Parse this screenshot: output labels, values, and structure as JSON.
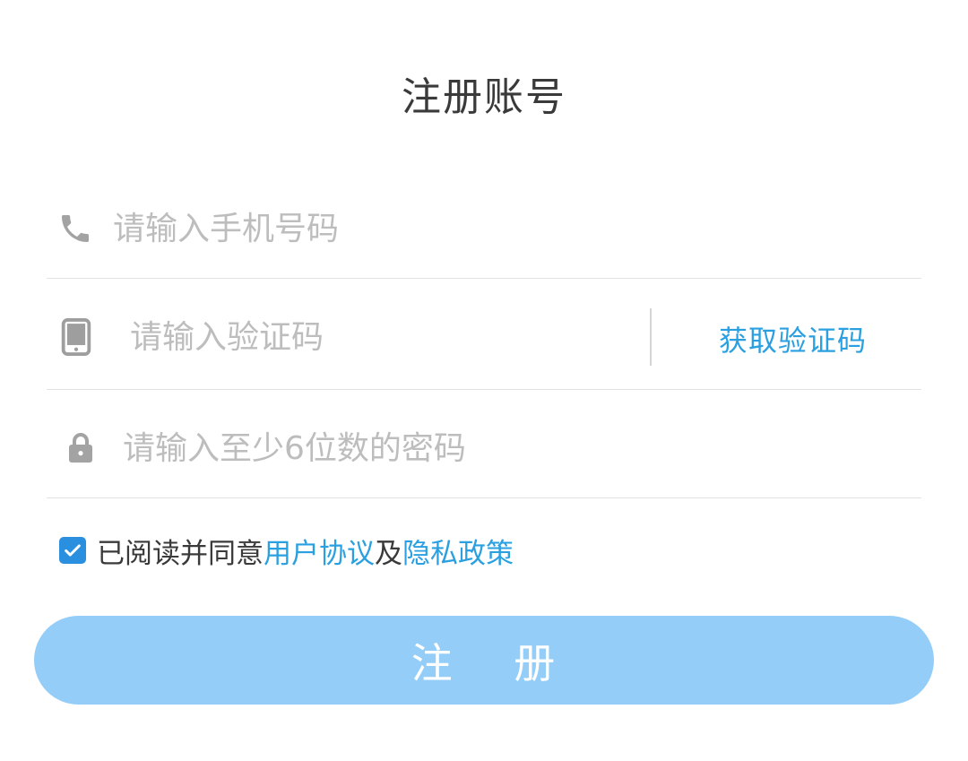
{
  "header": {
    "title": "注册账号"
  },
  "form": {
    "phone": {
      "icon": "phone-icon",
      "value": "",
      "placeholder": "请输入手机号码"
    },
    "code": {
      "icon": "mobile-device-icon",
      "value": "",
      "placeholder": "请输入验证码",
      "get_code_label": "获取验证码"
    },
    "password": {
      "icon": "lock-icon",
      "value": "",
      "placeholder": "请输入至少6位数的密码"
    }
  },
  "agreement": {
    "checked": true,
    "prefix": "已阅读并同意",
    "user_agreement": "用户协议",
    "conjunction": "及",
    "privacy_policy": "隐私政策"
  },
  "submit": {
    "label": "注    册"
  },
  "colors": {
    "accent": "#2ba0e0",
    "checkbox": "#2b8fe0",
    "button": "#93cdf8",
    "placeholder": "#bdbdbd"
  }
}
